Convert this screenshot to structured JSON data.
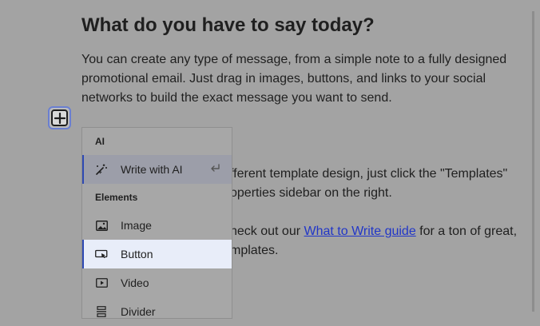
{
  "page": {
    "heading": "What do you have to say today?",
    "intro": "You can create any type of message, from a simple note to a fully designed promotional email. Just drag in images, buttons, and links to your social networks to build the exact message you want to send.",
    "templates_text": "fferent template design, just click the \"Templates\"",
    "templates_text_2": "operties sidebar on the right.",
    "guide_before": "heck out our ",
    "guide_link": "What to Write guide",
    "guide_after": " for a ton of great,",
    "guide_line2": "mplates."
  },
  "add_block": {
    "icon": "plus-icon"
  },
  "menu": {
    "ai_section": "AI",
    "write_ai": {
      "label": "Write with AI",
      "icon": "magic-wand-icon",
      "shortcut_icon": "enter-return-icon"
    },
    "elements_section": "Elements",
    "items": [
      {
        "label": "Image",
        "icon": "image-icon"
      },
      {
        "label": "Button",
        "icon": "button-cursor-icon"
      },
      {
        "label": "Video",
        "icon": "video-icon"
      },
      {
        "label": "Divider",
        "icon": "divider-icon"
      }
    ]
  },
  "colors": {
    "accent": "#2f4ab4",
    "link": "#2136c8",
    "selected_bg": "#e8edf9"
  }
}
